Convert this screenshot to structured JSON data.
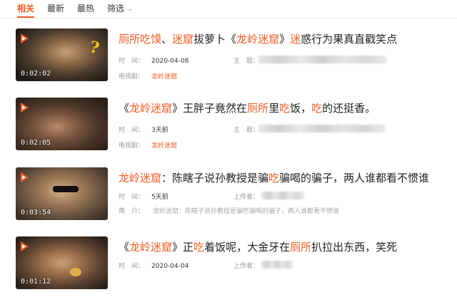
{
  "tabs": [
    {
      "label": "相关",
      "active": true
    },
    {
      "label": "最新",
      "active": false
    },
    {
      "label": "最热",
      "active": false
    },
    {
      "label": "筛选",
      "active": false,
      "dropdown": true
    }
  ],
  "accent_color": "#f25d23",
  "items": [
    {
      "duration": "0:02:02",
      "title_parts": [
        {
          "text": "厕所吃馍",
          "hl": true
        },
        {
          "text": "、",
          "hl": false
        },
        {
          "text": "迷窟",
          "hl": true
        },
        {
          "text": "拔萝卜《",
          "hl": false
        },
        {
          "text": "龙岭迷窟",
          "hl": true
        },
        {
          "text": "》",
          "hl": false
        },
        {
          "text": "迷",
          "hl": true
        },
        {
          "text": "惑行为果真直戳笑点",
          "hl": false
        }
      ],
      "time_label": "时　间：",
      "time_value": "2020-04-08",
      "owner_label": "主　题：",
      "extra_label": "电视剧：",
      "extra_value": "龙岭迷窟"
    },
    {
      "duration": "0:02:05",
      "title_parts": [
        {
          "text": "《",
          "hl": false
        },
        {
          "text": "龙岭迷窟",
          "hl": true
        },
        {
          "text": "》王胖子竟然在",
          "hl": false
        },
        {
          "text": "厕所",
          "hl": true
        },
        {
          "text": "里",
          "hl": false
        },
        {
          "text": "吃",
          "hl": true
        },
        {
          "text": "饭，",
          "hl": false
        },
        {
          "text": "吃",
          "hl": true
        },
        {
          "text": "的还挺香。",
          "hl": false
        }
      ],
      "time_label": "时　间：",
      "time_value": "3天前",
      "owner_label": "主　题：",
      "extra_label": "电视剧：",
      "extra_value": "龙岭迷窟"
    },
    {
      "duration": "0:03:54",
      "title_parts": [
        {
          "text": "龙岭迷窟",
          "hl": true
        },
        {
          "text": "：陈瞎子说孙教授是骗",
          "hl": false
        },
        {
          "text": "吃",
          "hl": true
        },
        {
          "text": "骗喝的骗子，两人谁都看不惯谁",
          "hl": false
        }
      ],
      "time_label": "时　间：",
      "time_value": "5天前",
      "owner_label": "上传者：",
      "extra_label": "简　介：",
      "extra_value": "龙岭迷窟：陈瞎子说孙教授是骗吃骗喝的骗子，两人谁都看不惯谁"
    },
    {
      "duration": "0:01:12",
      "title_parts": [
        {
          "text": "《",
          "hl": false
        },
        {
          "text": "龙岭迷窟",
          "hl": true
        },
        {
          "text": "》正",
          "hl": false
        },
        {
          "text": "吃",
          "hl": true
        },
        {
          "text": "着饭呢，大金牙在",
          "hl": false
        },
        {
          "text": "厕所",
          "hl": true
        },
        {
          "text": "扒拉出东西，笑死",
          "hl": false
        }
      ],
      "time_label": "时　间：",
      "time_value": "2020-04-04",
      "owner_label": "上传者：",
      "extra_label": "",
      "extra_value": ""
    }
  ]
}
